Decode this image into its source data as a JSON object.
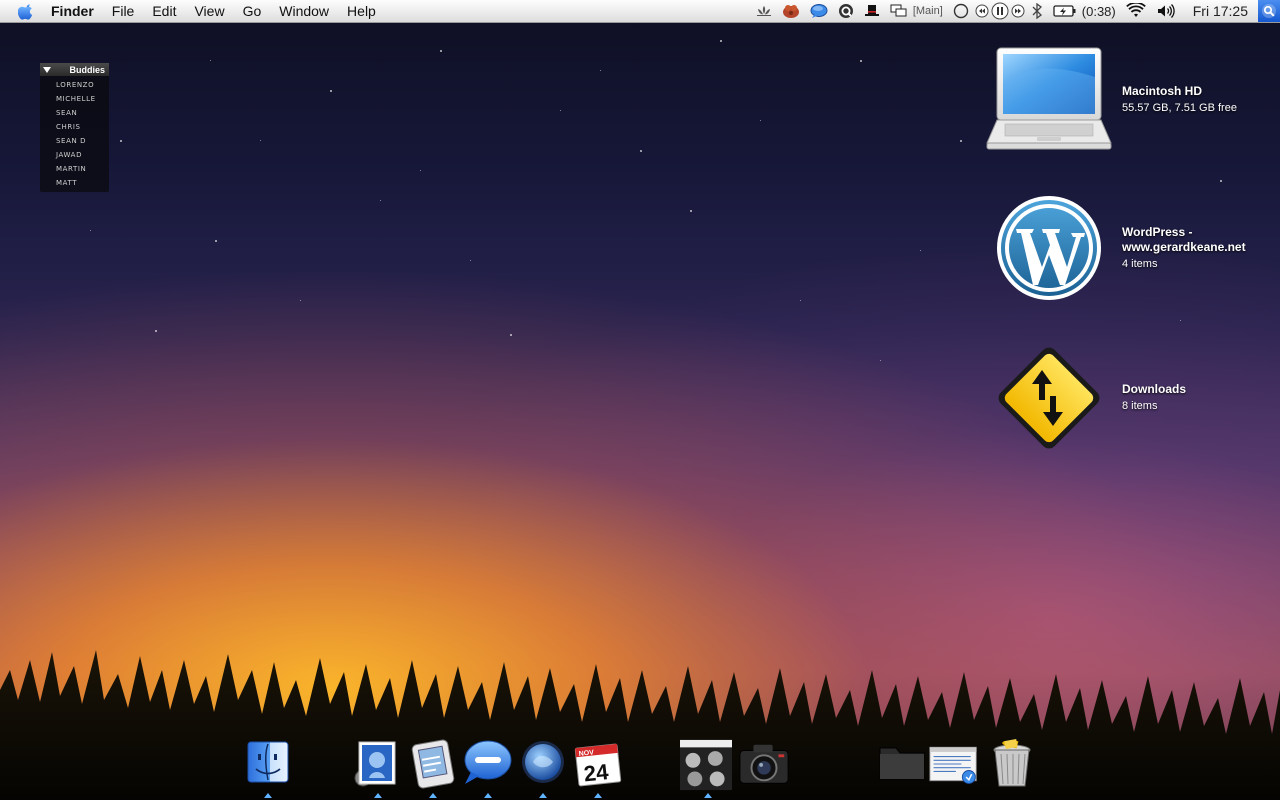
{
  "menubar": {
    "app_name": "Finder",
    "menus": [
      "File",
      "Edit",
      "View",
      "Go",
      "Window",
      "Help"
    ],
    "space_label": "[Main]",
    "battery_time": "(0:38)",
    "clock": "Fri 17:25"
  },
  "buddies": {
    "title": "Buddies",
    "items": [
      "LORENZO",
      "MICHELLE",
      "SEAN",
      "CHRIS",
      "SEAN D",
      "JAWAD",
      "MARTIN",
      "MATT"
    ]
  },
  "desktop_icons": [
    {
      "name": "Macintosh HD",
      "sub": "55.57 GB, 7.51 GB free",
      "icon": "laptop-icon"
    },
    {
      "name": "WordPress -",
      "name2": "www.gerardkeane.net",
      "sub": "4 items",
      "icon": "wordpress-icon"
    },
    {
      "name": "Downloads",
      "sub": "8 items",
      "icon": "road-sign-icon"
    }
  ],
  "calendar_icon": {
    "month": "NOV",
    "day": "24"
  },
  "colors": {
    "menubar_top": "#fdfdfd",
    "menubar_bottom": "#dcdcdc",
    "spotlight": "#1558cf",
    "wordpress_blue": "#21759b",
    "sign_yellow": "#ffd21a"
  }
}
